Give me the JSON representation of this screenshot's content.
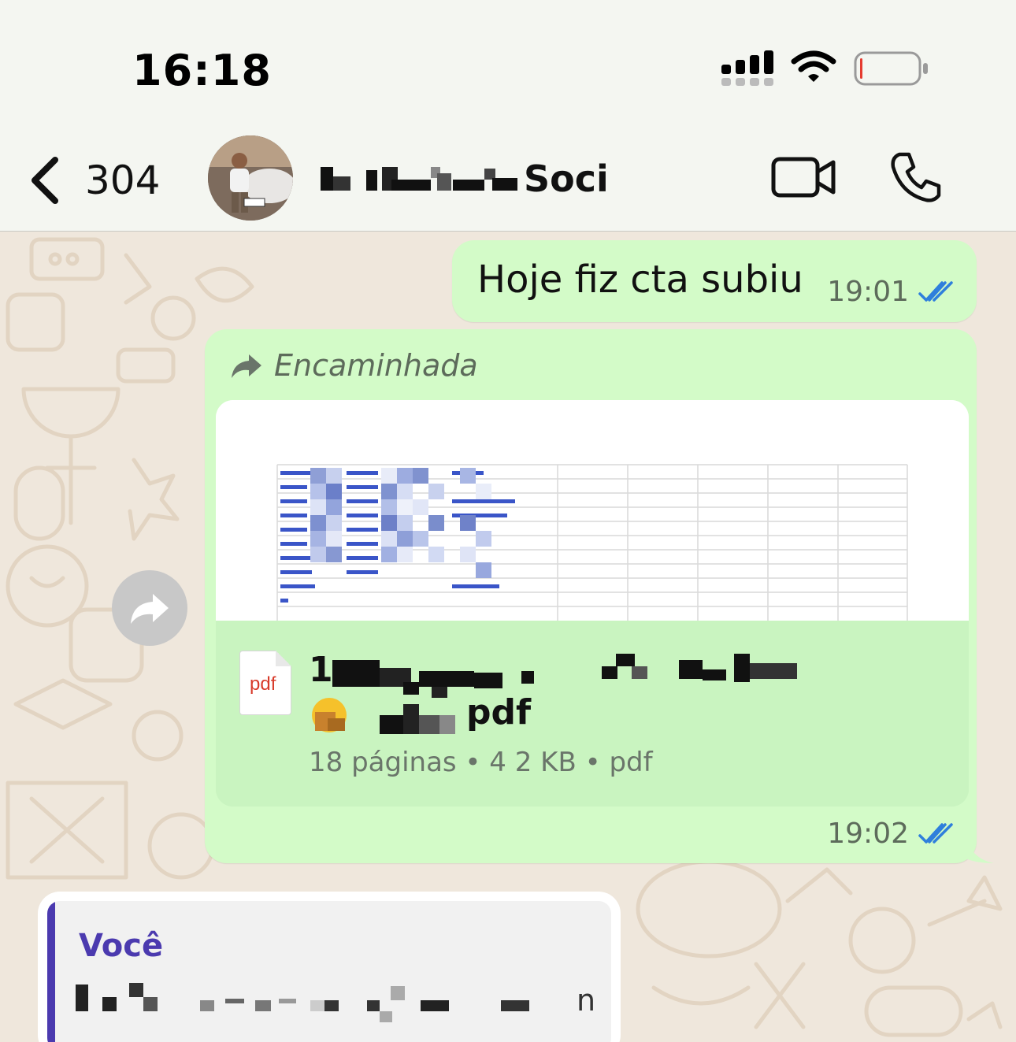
{
  "status_bar": {
    "time": "16:18",
    "signal_icon": "cellular-signal-icon",
    "wifi_icon": "wifi-icon",
    "battery_icon": "battery-low-icon"
  },
  "header": {
    "back_count": "304",
    "contact_name": "Soci",
    "back_icon": "chevron-left-icon",
    "video_icon": "video-camera-icon",
    "call_icon": "phone-icon"
  },
  "messages": [
    {
      "text": "Hoje fiz cta subiu",
      "time": "19:01",
      "status_icon": "double-check-read-icon"
    },
    {
      "forwarded_label": "Encaminhada",
      "document": {
        "type_label": "pdf",
        "name_visible": "1",
        "name_line2": "pdf",
        "meta": "18 páginas • 4 2 KB • pdf"
      },
      "time": "19:02",
      "status_icon": "double-check-read-icon"
    }
  ],
  "quote": {
    "author": "Você",
    "text": "n"
  },
  "colors": {
    "outgoing_bubble": "#d3fbc8",
    "read_check": "#2f7fdc",
    "quote_accent": "#4b3aaf",
    "wallpaper": "#efe7dc"
  }
}
